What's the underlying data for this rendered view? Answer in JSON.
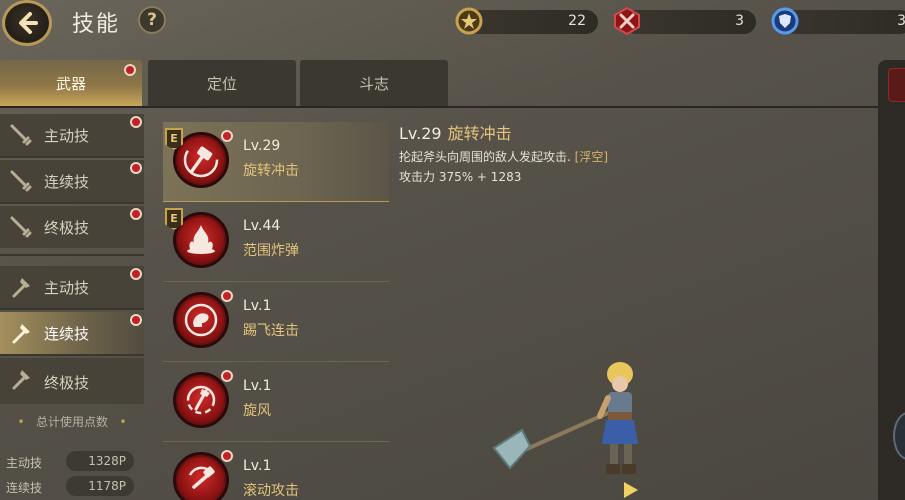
{
  "header": {
    "title": "技能",
    "help_label": "?",
    "currencies": [
      {
        "icon": "gold-gear-icon",
        "value": "22",
        "color": "#c9a24c"
      },
      {
        "icon": "red-crossed-swords-icon",
        "value": "3",
        "color": "#b8202a"
      },
      {
        "icon": "blue-shield-icon",
        "value": "3",
        "color": "#2a6ad0"
      }
    ]
  },
  "tabs": [
    {
      "label": "武器",
      "active": true,
      "has_alert": true
    },
    {
      "label": "定位",
      "active": false,
      "has_alert": false
    },
    {
      "label": "斗志",
      "active": false,
      "has_alert": false
    }
  ],
  "categories": [
    {
      "label": "主动技",
      "icon": "sword-icon",
      "active": false,
      "has_alert": true
    },
    {
      "label": "连续技",
      "icon": "sword-icon",
      "active": false,
      "has_alert": true
    },
    {
      "label": "终极技",
      "icon": "sword-icon",
      "active": false,
      "has_alert": true
    },
    {
      "label": "主动技",
      "icon": "axe-icon",
      "active": false,
      "has_alert": true
    },
    {
      "label": "连续技",
      "icon": "axe-icon",
      "active": true,
      "has_alert": true
    },
    {
      "label": "终极技",
      "icon": "axe-icon",
      "active": false,
      "has_alert": false
    }
  ],
  "points": {
    "title": "总计使用点数",
    "rows": [
      {
        "label": "主动技",
        "value": "1328P"
      },
      {
        "label": "连续技",
        "value": "1178P"
      }
    ]
  },
  "skills": [
    {
      "level": "Lv.29",
      "name": "旋转冲击",
      "badge": "E",
      "active": true,
      "has_alert": true,
      "icon": "hammer-swing-icon"
    },
    {
      "level": "Lv.44",
      "name": "范围炸弹",
      "badge": "E",
      "active": false,
      "has_alert": false,
      "icon": "explosion-icon"
    },
    {
      "level": "Lv.1",
      "name": "踢飞连击",
      "badge": "",
      "active": false,
      "has_alert": true,
      "icon": "kick-icon"
    },
    {
      "level": "Lv.1",
      "name": "旋风",
      "badge": "",
      "active": false,
      "has_alert": true,
      "icon": "whirlwind-axe-icon"
    },
    {
      "level": "Lv.1",
      "name": "滚动攻击",
      "badge": "",
      "active": false,
      "has_alert": true,
      "icon": "rolling-hammer-icon"
    }
  ],
  "detail": {
    "level": "Lv.29",
    "name": "旋转冲击",
    "description": "抡起斧头向周围的敌人发起攻击. ",
    "tag": "[浮空]",
    "stat": "攻击力 375% + 1283"
  },
  "colors": {
    "accent_gold": "#c9a24c",
    "alert_red": "#c2202a",
    "skill_name": "#e4c37a"
  }
}
